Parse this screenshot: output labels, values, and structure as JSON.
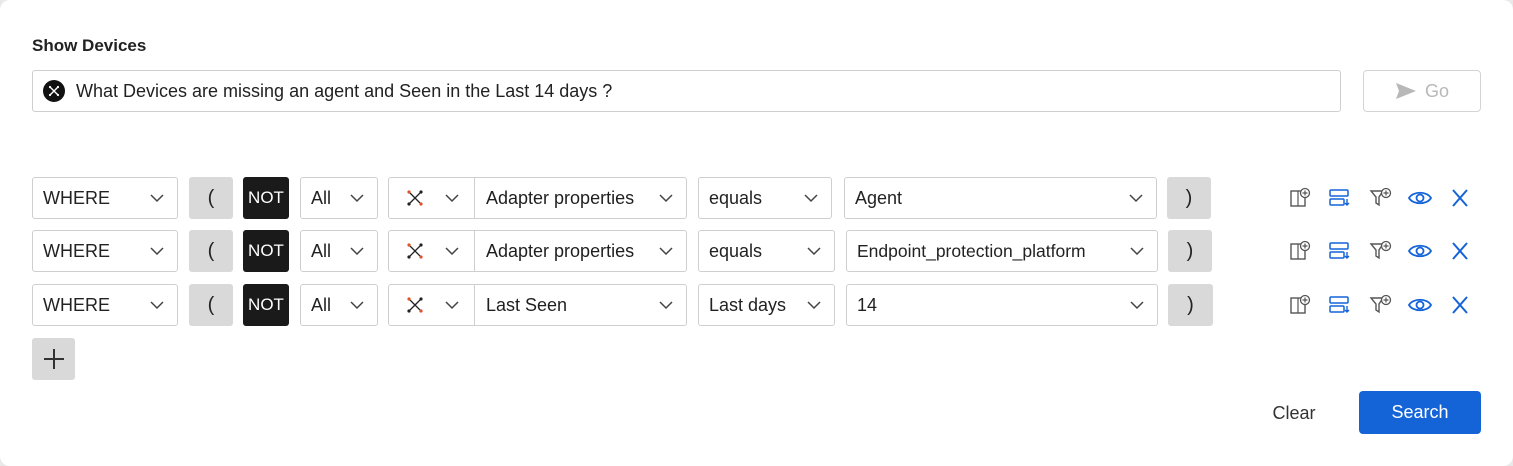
{
  "header": {
    "title": "Show Devices"
  },
  "query": {
    "text": "What Devices are missing an agent and Seen in the Last 14 days ?",
    "go_label": "Go"
  },
  "rows": [
    {
      "logic": "WHERE",
      "open_paren": "(",
      "not_label": "NOT",
      "scope": "All",
      "field": "Adapter properties",
      "operator": "equals",
      "value": "Agent",
      "close_paren": ")"
    },
    {
      "logic": "WHERE",
      "open_paren": "(",
      "not_label": "NOT",
      "scope": "All",
      "field": "Adapter properties",
      "operator": "equals",
      "value": "Endpoint_protection_platform",
      "close_paren": ")"
    },
    {
      "logic": "WHERE",
      "open_paren": "(",
      "not_label": "NOT",
      "scope": "All",
      "field": "Last Seen",
      "operator": "Last days",
      "value": "14",
      "close_paren": ")"
    }
  ],
  "footer": {
    "clear_label": "Clear",
    "search_label": "Search"
  },
  "colors": {
    "accent": "#1464d8",
    "not_bg": "#1a1a1a",
    "paren_bg": "#d9d9d9"
  }
}
